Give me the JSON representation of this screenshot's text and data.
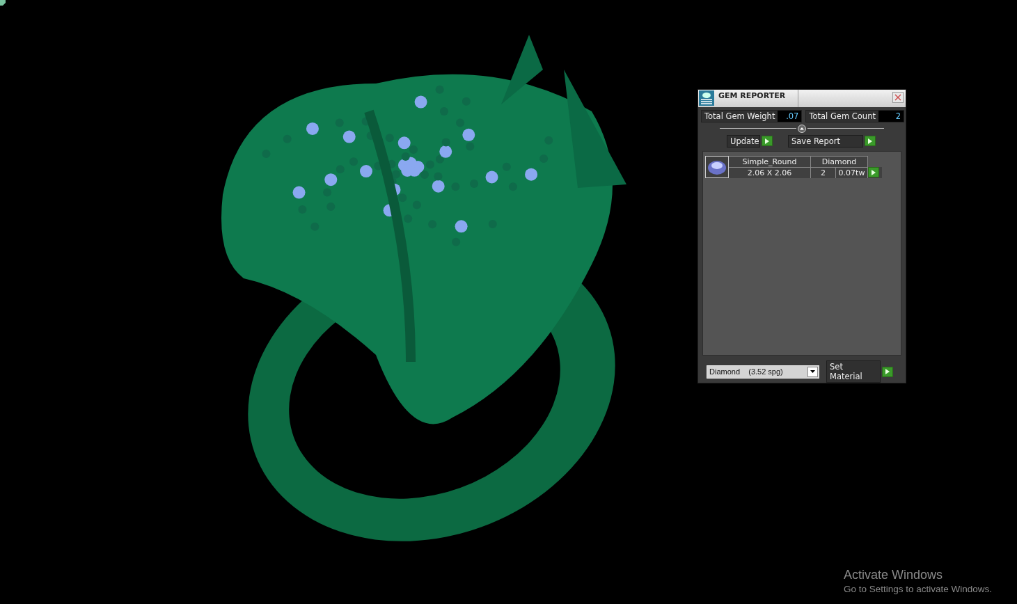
{
  "window": {
    "title": "GEM REPORTER"
  },
  "totals": [
    {
      "label": "Total Gem Weight",
      "value": ".07"
    },
    {
      "label": "Total Gem Count",
      "value": "2"
    }
  ],
  "actions": [
    "Update",
    "Save Report"
  ],
  "gems": [
    {
      "shape": "Simple_Round",
      "material": "Diamond",
      "size": "2.06 X 2.06",
      "count": "2",
      "weight": "0.07tw"
    }
  ],
  "material_select": {
    "value": "Diamond    (3.52 spg)"
  },
  "material_button": "Set Material",
  "os_notice": {
    "title": "Activate Windows",
    "text": "Go to Settings to activate Windows."
  }
}
